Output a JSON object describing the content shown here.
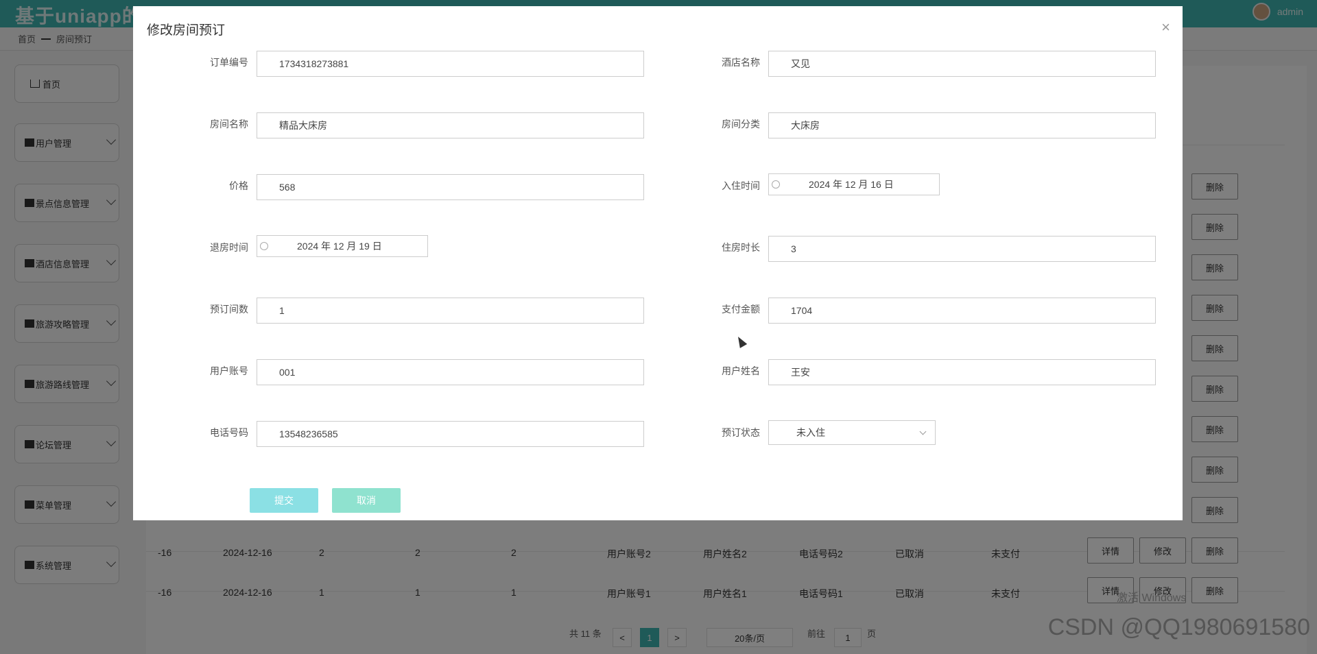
{
  "header": {
    "brand": "基于uniapp的",
    "user": "admin"
  },
  "breadcrumb": {
    "home": "首页",
    "current": "房间预订"
  },
  "sidebar": {
    "items": [
      {
        "label": "首页"
      },
      {
        "label": "用户管理"
      },
      {
        "label": "景点信息管理"
      },
      {
        "label": "酒店信息管理"
      },
      {
        "label": "旅游攻略管理"
      },
      {
        "label": "旅游路线管理"
      },
      {
        "label": "论坛管理"
      },
      {
        "label": "菜单管理"
      },
      {
        "label": "系统管理"
      }
    ]
  },
  "table": {
    "rows": [
      {
        "c0": "-16",
        "c1": "2024-12-16",
        "c2": "2",
        "c3": "2",
        "c4": "2",
        "c5": "用户账号2",
        "c6": "用户姓名2",
        "c7": "电话号码2",
        "c8": "已取消",
        "c9": "未支付"
      },
      {
        "c0": "-16",
        "c1": "2024-12-16",
        "c2": "1",
        "c3": "1",
        "c4": "1",
        "c5": "用户账号1",
        "c6": "用户姓名1",
        "c7": "电话号码1",
        "c8": "已取消",
        "c9": "未支付"
      }
    ],
    "op_detail": "详情",
    "op_edit": "修改",
    "op_delete": "删除"
  },
  "pager": {
    "total": "共 11 条",
    "prev": "<",
    "current": "1",
    "next": ">",
    "size": "20条/页",
    "goto": "前往",
    "goto_value": "1",
    "page_unit": "页"
  },
  "dialog": {
    "title": "修改房间预订",
    "close": "×",
    "fields": {
      "order_no_label": "订单编号",
      "order_no": "1734318273881",
      "hotel_label": "酒店名称",
      "hotel": "又见",
      "room_label": "房间名称",
      "room": "精品大床房",
      "category_label": "房间分类",
      "category": "大床房",
      "price_label": "价格",
      "price": "568",
      "checkin_label": "入住时间",
      "checkin": "2024 年 12 月 16 日",
      "checkout_label": "退房时间",
      "checkout": "2024 年 12 月 19 日",
      "duration_label": "住房时长",
      "duration": "3",
      "rooms_label": "预订间数",
      "rooms": "1",
      "amount_label": "支付金额",
      "amount": "1704",
      "account_label": "用户账号",
      "account": "001",
      "name_label": "用户姓名",
      "name": "王安",
      "phone_label": "电话号码",
      "phone": "13548236585",
      "status_label": "预订状态",
      "status": "未入住"
    },
    "submit": "提交",
    "cancel": "取消"
  },
  "watermark": "CSDN @QQ1980691580",
  "windows_notice": "激活 Windows",
  "colors": {
    "topbar": "#3fb5b0",
    "submit": "#8be0e4",
    "cancel": "#8fe2cf",
    "pager_active": "#3fb5b0"
  }
}
